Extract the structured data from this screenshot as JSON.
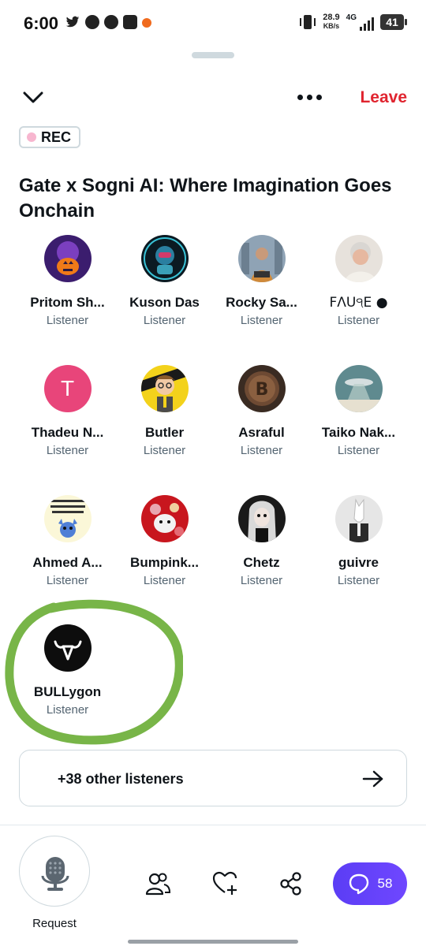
{
  "status_bar": {
    "time": "6:00",
    "net_speed_value": "28.9",
    "net_speed_unit": "KB/s",
    "network": "4G",
    "battery": "41"
  },
  "header": {
    "leave_label": "Leave",
    "rec_label": "REC"
  },
  "space": {
    "title": "Gate x Sogni AI: Where Imagination Goes Onchain"
  },
  "listeners": [
    {
      "name": "Pritom Sh...",
      "role": "Listener",
      "avatar": "halloween-pumpkin-avatar"
    },
    {
      "name": "Kuson Das",
      "role": "Listener",
      "avatar": "robot-avatar"
    },
    {
      "name": "Rocky Sa...",
      "role": "Listener",
      "avatar": "city-portrait-avatar"
    },
    {
      "name": "FΛU੧E ●",
      "role": "Listener",
      "avatar": "elderly-woman-avatar"
    },
    {
      "name": "Thadeu N...",
      "role": "Listener",
      "avatar": "letter-avatar",
      "letter": "T"
    },
    {
      "name": "Butler",
      "role": "Listener",
      "avatar": "cartoon-boy-avatar"
    },
    {
      "name": "Asraful",
      "role": "Listener",
      "avatar": "bitcoin-coin-avatar"
    },
    {
      "name": "Taiko Nak...",
      "role": "Listener",
      "avatar": "ufo-landscape-avatar"
    },
    {
      "name": "Ahmed A...",
      "role": "Listener",
      "avatar": "stitch-quote-avatar"
    },
    {
      "name": "Bumpink...",
      "role": "Listener",
      "avatar": "red-toy-avatar"
    },
    {
      "name": "Chetz",
      "role": "Listener",
      "avatar": "gothic-girl-avatar"
    },
    {
      "name": "guivre",
      "role": "Listener",
      "avatar": "white-horse-avatar"
    },
    {
      "name": "BULLygon",
      "role": "Listener",
      "avatar": "bull-logo-avatar"
    }
  ],
  "others": {
    "label": "+38 other listeners"
  },
  "bottom_bar": {
    "request_label": "Request",
    "chat_count": "58"
  },
  "colors": {
    "leave": "#e0242f",
    "chat_button": "#5b3df5",
    "annotation": "#78b548",
    "letter_avatar": "#e8457a"
  }
}
